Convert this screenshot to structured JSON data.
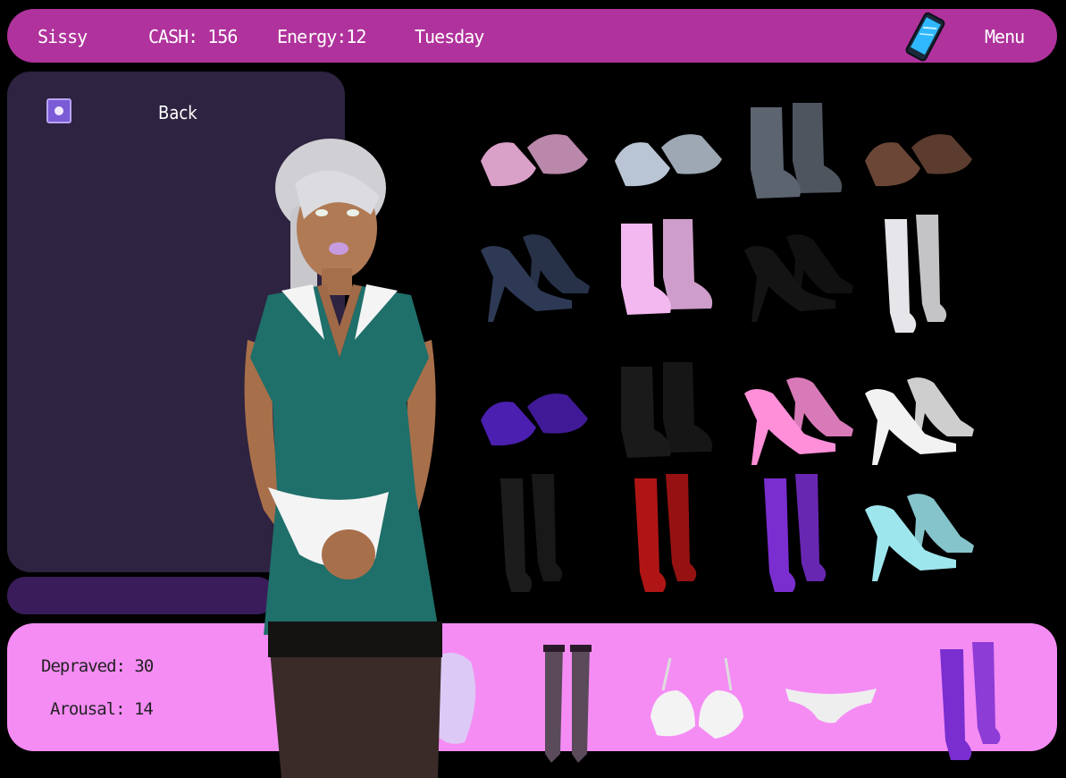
{
  "topbar": {
    "name": "Sissy",
    "cash": "CASH: 156",
    "energy": "Energy:12",
    "day": "Tuesday",
    "menu_label": "Menu"
  },
  "left_panel": {
    "back_label": "Back"
  },
  "stats": {
    "depraved": "Depraved: 30",
    "arousal": "Arousal: 14"
  },
  "shoes": [
    {
      "name": "pink sandals",
      "color": "#d9a0c8"
    },
    {
      "name": "silver mules",
      "color": "#b9c5d4"
    },
    {
      "name": "grey lace-up boots",
      "color": "#5c6470"
    },
    {
      "name": "brown mary janes",
      "color": "#6b4636"
    },
    {
      "name": "navy pumps",
      "color": "#2e3a55"
    },
    {
      "name": "pink platform boots",
      "color": "#f2b8ef"
    },
    {
      "name": "black platform pumps",
      "color": "#141414"
    },
    {
      "name": "white thigh boots",
      "color": "#e6e6ea"
    },
    {
      "name": "purple creepers",
      "color": "#4b1fb0"
    },
    {
      "name": "black studded boots",
      "color": "#1a1a1a"
    },
    {
      "name": "pink stilettos",
      "color": "#ff8fd8"
    },
    {
      "name": "white strappy heels",
      "color": "#f2f2f2"
    },
    {
      "name": "black thigh boots",
      "color": "#1c1c1c"
    },
    {
      "name": "red knee boots",
      "color": "#b01515"
    },
    {
      "name": "purple thigh boots",
      "color": "#7a2ed0"
    },
    {
      "name": "aqua platform heels",
      "color": "#9ee6ee"
    }
  ],
  "equipped": [
    {
      "name": "chastity device",
      "color": "#d8d4f4"
    },
    {
      "name": "fishnet stockings",
      "color": "#5a4a5a"
    },
    {
      "name": "white bra",
      "color": "#f3f3f3"
    },
    {
      "name": "white panties",
      "color": "#eeeeee"
    },
    {
      "name": "purple thigh boots",
      "color": "#7a2ed0"
    }
  ],
  "colors": {
    "topbar": "#b0329c",
    "panel": "#2e2340",
    "bottombar": "#f58cf4"
  }
}
